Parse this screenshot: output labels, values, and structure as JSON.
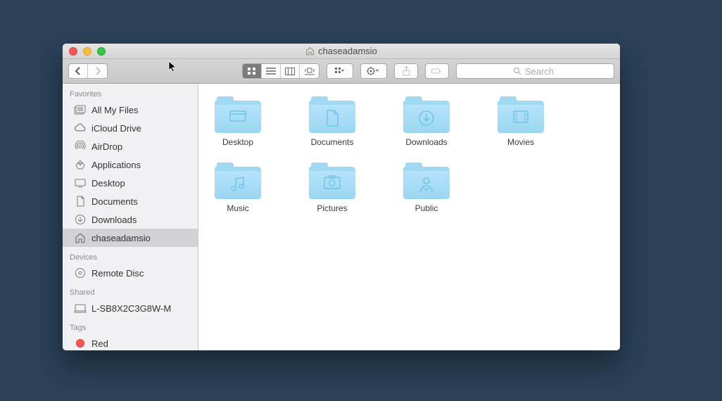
{
  "window": {
    "title": "chaseadamsio"
  },
  "search": {
    "placeholder": "Search"
  },
  "sidebar": {
    "sections": [
      {
        "header": "Favorites",
        "items": [
          {
            "label": "All My Files",
            "icon": "all-files"
          },
          {
            "label": "iCloud Drive",
            "icon": "cloud"
          },
          {
            "label": "AirDrop",
            "icon": "airdrop"
          },
          {
            "label": "Applications",
            "icon": "apps"
          },
          {
            "label": "Desktop",
            "icon": "desktop"
          },
          {
            "label": "Documents",
            "icon": "documents"
          },
          {
            "label": "Downloads",
            "icon": "downloads"
          },
          {
            "label": "chaseadamsio",
            "icon": "home",
            "selected": true
          }
        ]
      },
      {
        "header": "Devices",
        "items": [
          {
            "label": "Remote Disc",
            "icon": "disc"
          }
        ]
      },
      {
        "header": "Shared",
        "items": [
          {
            "label": "L-SB8X2C3G8W-M",
            "icon": "computer"
          }
        ]
      },
      {
        "header": "Tags",
        "items": [
          {
            "label": "Red",
            "icon": "tag-red"
          }
        ]
      }
    ]
  },
  "folders": [
    {
      "label": "Desktop",
      "glyph": "desktop"
    },
    {
      "label": "Documents",
      "glyph": "document"
    },
    {
      "label": "Downloads",
      "glyph": "download"
    },
    {
      "label": "Movies",
      "glyph": "movie"
    },
    {
      "label": "Music",
      "glyph": "music"
    },
    {
      "label": "Pictures",
      "glyph": "picture"
    },
    {
      "label": "Public",
      "glyph": "public"
    }
  ]
}
